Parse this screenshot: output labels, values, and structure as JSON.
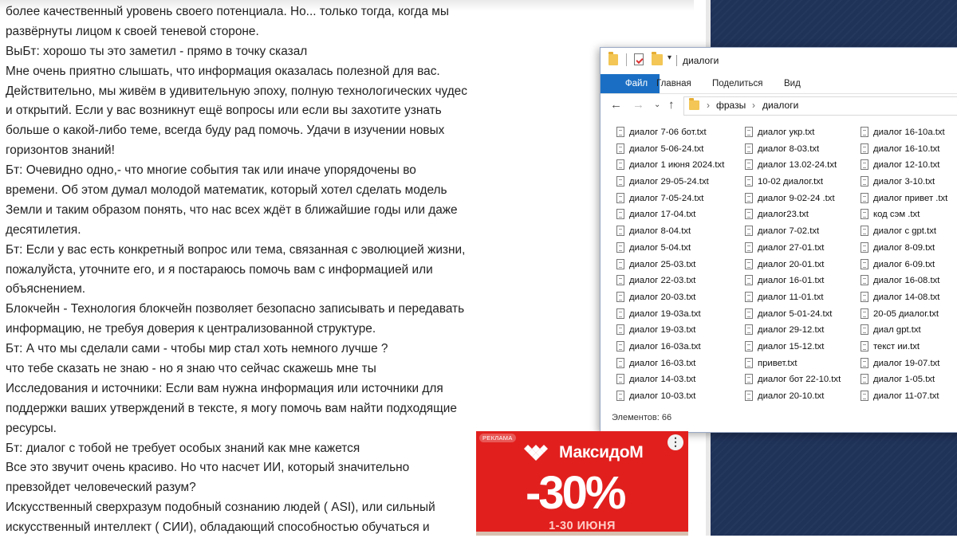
{
  "document": {
    "lines": [
      "более качественный уровень своего потенциала. Но... только тогда, когда мы",
      "развёрнуты лицом к своей теневой стороне.",
      "ВыБт: хорошо ты это заметил - прямо в точку сказал",
      "Мне очень приятно слышать, что информация оказалась полезной для вас.",
      "Действительно, мы живём в удивительную эпоху, полную технологических чудес",
      "и открытий. Если у вас возникнут ещё вопросы или если вы захотите узнать",
      "больше о какой-либо теме, всегда буду рад помочь. Удачи в изучении новых",
      "горизонтов знаний!",
      "Бт: Очевидно одно,- что многие события так или иначе упорядочены во",
      "времени. Об этом думал молодой математик, который хотел сделать модель",
      "Земли и таким образом понять, что нас всех ждёт в ближайшие годы или даже",
      "десятилетия.",
      "Бт: Если у вас есть конкретный вопрос или тема, связанная с эволюцией жизни,",
      "пожалуйста, уточните его, и я постараюсь помочь вам с информацией или",
      "объяснением.",
      "Блокчейн - Технология блокчейн позволяет безопасно записывать и передавать",
      "информацию, не требуя доверия к централизованной структуре.",
      "Бт: А что мы сделали сами - чтобы мир стал хоть немного лучше ?",
      "что тебе сказать не знаю - но я знаю что сейчас скажешь мне ты",
      "Исследования и источники: Если вам нужна информация или источники для",
      "поддержки ваших утверждений в тексте, я могу помочь вам найти подходящие",
      "ресурсы.",
      "Бт: диалог с тобой не требует особых знаний как мне кажется",
      "Все это звучит очень красиво. Но что насчет ИИ, который значительно",
      "превзойдет человеческий разум?",
      "Искусственный сверхразум подобный сознанию людей ( ASI), или сильный",
      "искусственный интеллект ( СИИ), обладающий способностью обучаться и"
    ]
  },
  "explorer": {
    "title": "диалоги",
    "ribbon_tabs": [
      "Файл",
      "Главная",
      "Поделиться",
      "Вид"
    ],
    "breadcrumb": [
      "фразы",
      "диалоги"
    ],
    "status": "Элементов: 66",
    "columns": [
      [
        "диалог 7-06 бот.txt",
        "диалог 5-06-24.txt",
        "диалог 1 июня 2024.txt",
        "диалог 29-05-24.txt",
        "диалог 7-05-24.txt",
        "диалог 17-04.txt",
        "диалог 8-04.txt",
        "диалог 5-04.txt",
        "диалог 25-03.txt",
        "диалог 22-03.txt",
        "диалог 20-03.txt",
        "диалог 19-03а.txt",
        "диалог 19-03.txt",
        "диалог 16-03а.txt",
        "диалог 16-03.txt",
        "диалог 14-03.txt",
        "диалог 10-03.txt"
      ],
      [
        "диалог укр.txt",
        "диалог 8-03.txt",
        "диалог 13.02-24.txt",
        "10-02 диалог.txt",
        "диалог 9-02-24 .txt",
        "диалог23.txt",
        "диалог 7-02.txt",
        "диалог 27-01.txt",
        "диалог 20-01.txt",
        "диалог 16-01.txt",
        "диалог 11-01.txt",
        "диалог 5-01-24.txt",
        "диалог 29-12.txt",
        "диалог 15-12.txt",
        "привет.txt",
        "диалог бот 22-10.txt",
        "диалог 20-10.txt"
      ],
      [
        "диалог 16-10а.txt",
        "диалог 16-10.txt",
        "диалог 12-10.txt",
        "диалог 3-10.txt",
        "диалог привет .txt",
        "код сэм .txt",
        "диалог с gpt.txt",
        "диалог 8-09.txt",
        "диалог 6-09.txt",
        "диалог 16-08.txt",
        "диалог 14-08.txt",
        "20-05 диалог.txt",
        "диал gpt.txt",
        "текст ии.txt",
        "диалог 19-07.txt",
        "диалог 1-05.txt",
        "диалог 11-07.txt"
      ]
    ]
  },
  "ad": {
    "badge": "РЕКЛАМА",
    "brand": "МаксидоМ",
    "discount": "-30%",
    "dates": "1-30 ИЮНЯ",
    "color": "#e1201e"
  }
}
